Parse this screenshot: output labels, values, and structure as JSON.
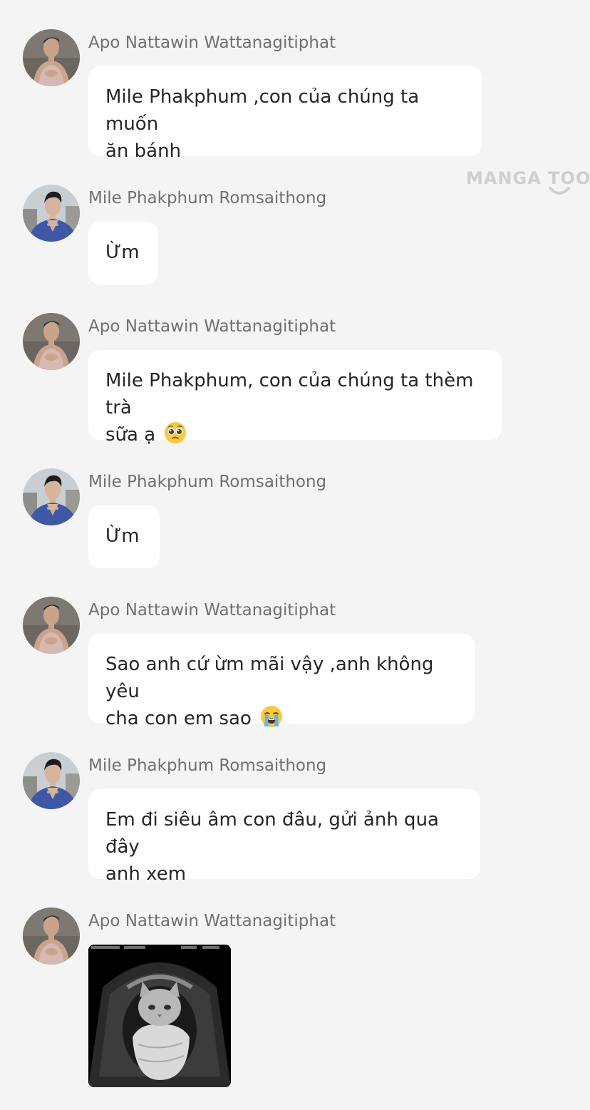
{
  "watermark": "MANGA TOON",
  "messages": [
    {
      "sender": "Apo Nattawin Wattanagitiphat",
      "text_line1": "Mile Phakphum ,con của chúng ta muốn",
      "text_line2": "ăn bánh"
    },
    {
      "sender": "Mile Phakphum Romsaithong",
      "text_line1": "Ừm"
    },
    {
      "sender": "Apo Nattawin Wattanagitiphat",
      "text_line1": "Mile Phakphum, con của chúng ta thèm trà",
      "text_line2": "sữa ạ",
      "emoji": "pleading-face"
    },
    {
      "sender": "Mile Phakphum Romsaithong",
      "text_line1": "Ừm"
    },
    {
      "sender": "Apo Nattawin Wattanagitiphat",
      "text_line1": "Sao anh cứ ừm mãi vậy ,anh không yêu",
      "text_line2": "cha con em sao",
      "emoji": "crying-face"
    },
    {
      "sender": "Mile Phakphum Romsaithong",
      "text_line1": "Em đi siêu âm con đâu, gửi ảnh qua đây",
      "text_line2": "anh xem"
    },
    {
      "sender": "Apo Nattawin Wattanagitiphat",
      "image": "ultrasound-cat-photo"
    }
  ],
  "colors": {
    "background": "#f4f4f4",
    "bubble": "#ffffff",
    "sender_text": "#707070",
    "message_text": "#262626",
    "watermark": "#cfcfcf"
  }
}
